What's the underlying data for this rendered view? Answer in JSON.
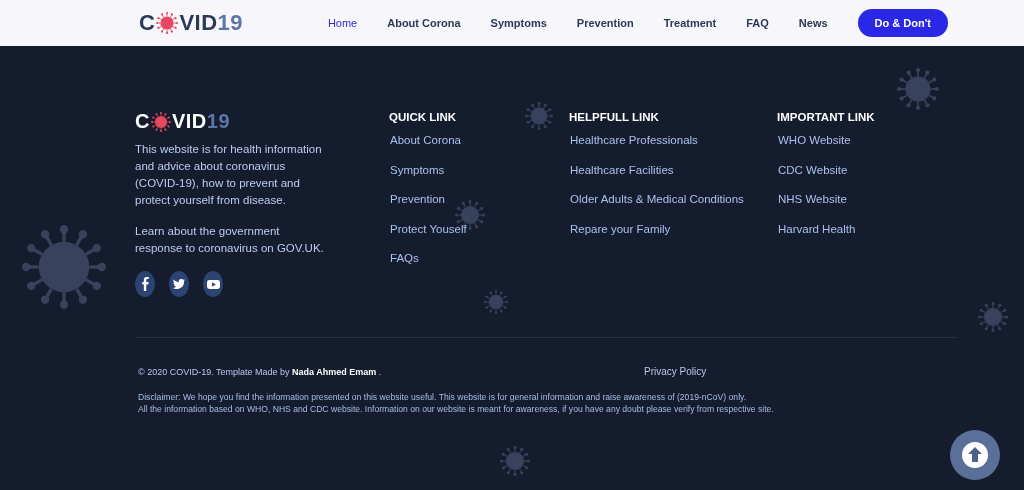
{
  "header": {
    "logo": {
      "before": "C",
      "after": "VID",
      "number": "19"
    },
    "nav": [
      {
        "label": "Home",
        "selected": true
      },
      {
        "label": "About Corona",
        "selected": false
      },
      {
        "label": "Symptoms",
        "selected": false
      },
      {
        "label": "Prevention",
        "selected": false
      },
      {
        "label": "Treatment",
        "selected": false
      },
      {
        "label": "FAQ",
        "selected": false
      },
      {
        "label": "News",
        "selected": false
      }
    ],
    "cta": "Do & Don't"
  },
  "footer": {
    "logo": {
      "before": "C",
      "after": "VID",
      "number": "19"
    },
    "about": [
      "This website is for health information and advice about coronavirus (COVID-19), how to prevent and protect yourself from disease.",
      "Learn about the government response to coronavirus on GOV.UK."
    ],
    "social": [
      {
        "kind": "facebook"
      },
      {
        "kind": "twitter"
      },
      {
        "kind": "youtube"
      }
    ],
    "columns": [
      {
        "title": "QUICK LINK",
        "links": [
          "About Corona",
          "Symptoms",
          "Prevention",
          "Protect Youself",
          "FAQs"
        ]
      },
      {
        "title": "HELPFULL LINK",
        "links": [
          "Healthcare Professionals",
          "Healthcare Facilities",
          "Older Adults & Medical Conditions",
          "Repare your Family"
        ]
      },
      {
        "title": "IMPORTANT LINK",
        "links": [
          "WHO Website",
          "CDC Website",
          "NHS Website",
          "Harvard Health"
        ]
      }
    ],
    "copyright": "© 2020 COVID-19. Template Made by **Nada Ahmed Emam** .",
    "privacy": "Privacy Policy",
    "disclaimer": [
      "Disclaimer: We hope you find the information presented on this website useful. This website is for general information and raise awareness of (2019-nCoV) only.",
      "All the information based on WHO, NHS and CDC website. Information on our website is meant for awareness, if you have any doubt please verify from respective site."
    ]
  }
}
